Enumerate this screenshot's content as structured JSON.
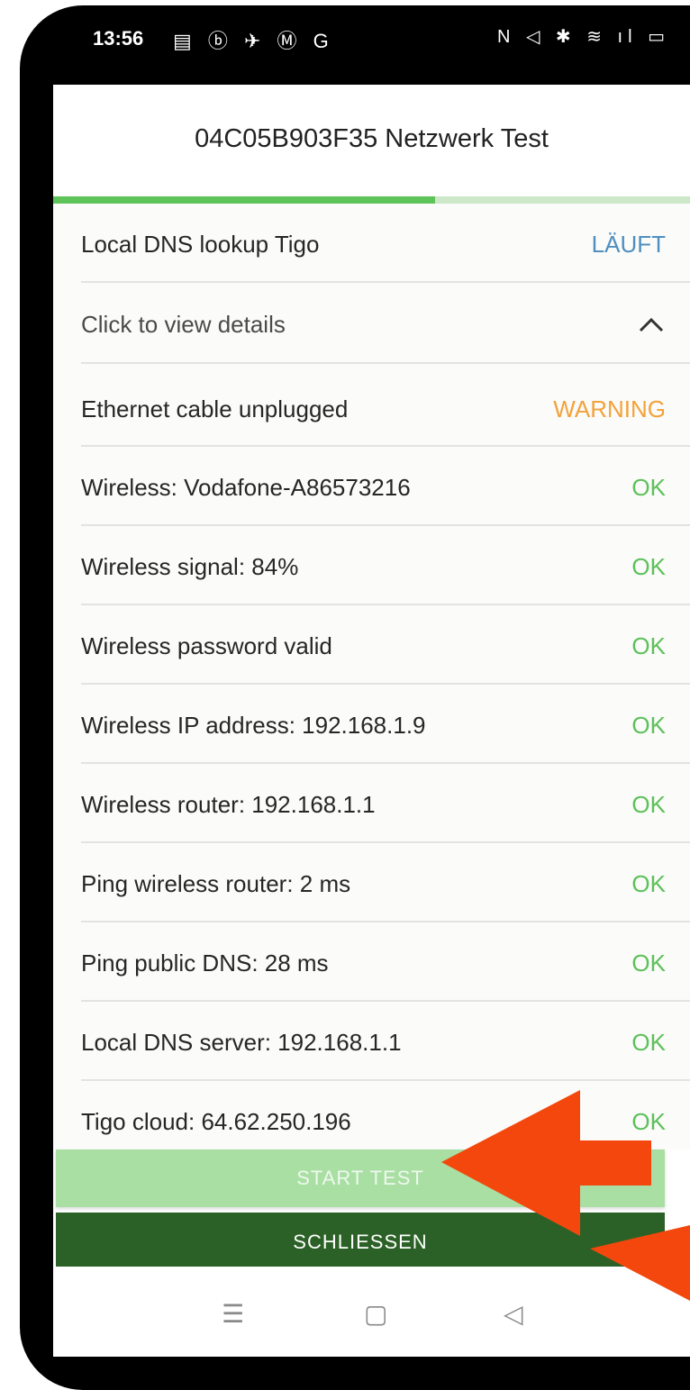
{
  "status_bar": {
    "time": "13:56",
    "left_icons": "▤ ⓑ ✈ Ⓜ G",
    "right_icons": "N ◁ ✱ ≋ ıl ▭"
  },
  "header": {
    "title": "04C05B903F35 Netzwerk Test"
  },
  "progress": {
    "fraction": 0.6
  },
  "list": {
    "running": {
      "label": "Local DNS lookup Tigo",
      "status": "LÄUFT"
    },
    "details": {
      "label": "Click to view details",
      "icon": "chevron-up-icon"
    },
    "rows": [
      {
        "label": "Ethernet cable unplugged",
        "status": "WARNING"
      },
      {
        "label": "Wireless: Vodafone-A86573216",
        "status": "OK"
      },
      {
        "label": "Wireless signal: 84%",
        "status": "OK"
      },
      {
        "label": "Wireless password valid",
        "status": "OK"
      },
      {
        "label": "Wireless IP address: 192.168.1.9",
        "status": "OK"
      },
      {
        "label": "Wireless router: 192.168.1.1",
        "status": "OK"
      },
      {
        "label": "Ping wireless router: 2 ms",
        "status": "OK"
      },
      {
        "label": "Ping public DNS: 28 ms",
        "status": "OK"
      },
      {
        "label": "Local DNS server: 192.168.1.1",
        "status": "OK"
      },
      {
        "label": "Tigo cloud: 64.62.250.196",
        "status": "OK"
      }
    ]
  },
  "buttons": {
    "start": "START TEST",
    "close": "SCHLIESSEN"
  },
  "navbar": {
    "menu": "☰",
    "home": "▢",
    "back": "◁"
  },
  "colors": {
    "running": "#4f8fc0",
    "warning": "#f3a23a",
    "ok": "#5cc15a",
    "annotation": "#f4470d"
  }
}
